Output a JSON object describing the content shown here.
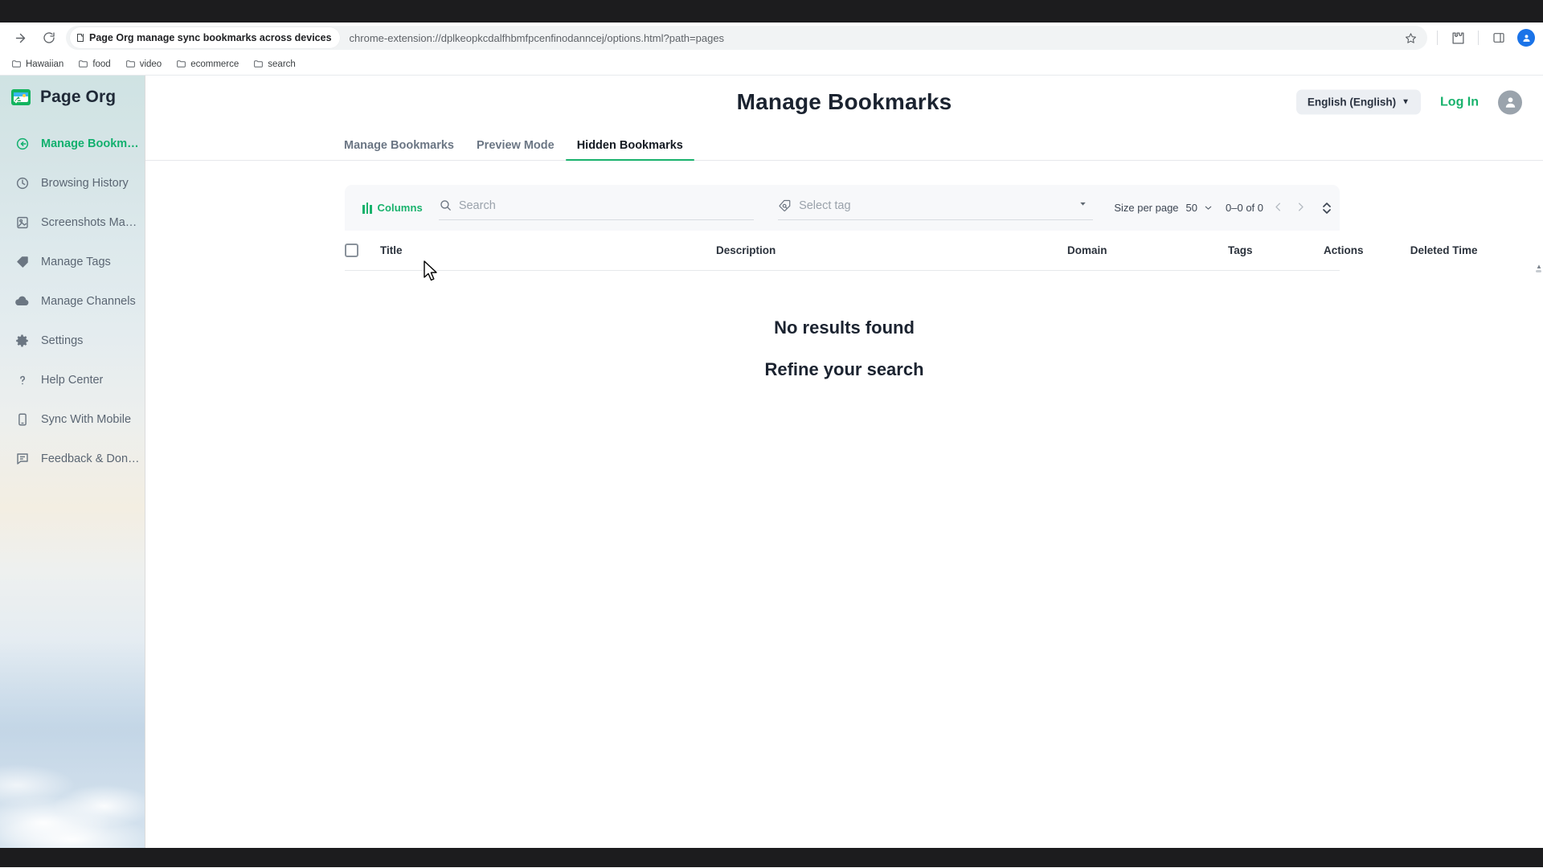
{
  "browser": {
    "forward_icon": "forward-arrow-icon",
    "reload_icon": "reload-icon",
    "omnibox_chip_label": "Page Org manage sync bookmarks across devices",
    "omnibox_chip_icon": "extension-puzzle-icon",
    "url": "chrome-extension://dplkeopkcdalfhbmfpcenfinodanncej/options.html?path=pages",
    "star_icon": "bookmark-star-icon",
    "extensions_icon": "extensions-puzzle-icon",
    "sidepanel_icon": "side-panel-icon",
    "profile_initial": "",
    "bookmarks": [
      {
        "label": "Hawaiian",
        "icon": "folder-icon"
      },
      {
        "label": "food",
        "icon": "folder-icon"
      },
      {
        "label": "video",
        "icon": "folder-icon"
      },
      {
        "label": "ecommerce",
        "icon": "folder-icon"
      },
      {
        "label": "search",
        "icon": "folder-icon"
      }
    ]
  },
  "sidebar": {
    "brand": "Page Org",
    "brand_icon": "page-org-logo-icon",
    "items": [
      {
        "label": "Manage Bookmarks",
        "icon": "bookmark-arrow-icon",
        "active": true
      },
      {
        "label": "Browsing History",
        "icon": "history-clock-icon",
        "active": false
      },
      {
        "label": "Screenshots Manage...",
        "icon": "screenshot-icon",
        "active": false
      },
      {
        "label": "Manage Tags",
        "icon": "tag-icon",
        "active": false
      },
      {
        "label": "Manage Channels",
        "icon": "cloud-icon",
        "active": false
      },
      {
        "label": "Settings",
        "icon": "gear-icon",
        "active": false
      },
      {
        "label": "Help Center",
        "icon": "question-mark-icon",
        "active": false
      },
      {
        "label": "Sync With Mobile",
        "icon": "mobile-sync-icon",
        "active": false
      },
      {
        "label": "Feedback & Donate",
        "icon": "feedback-icon",
        "active": false
      }
    ]
  },
  "header": {
    "title": "Manage Bookmarks",
    "language_label": "English (English)",
    "language_caret": "▼",
    "login_label": "Log In",
    "avatar_icon": "user-avatar-icon"
  },
  "tabs": [
    {
      "label": "Manage Bookmarks",
      "active": false
    },
    {
      "label": "Preview Mode",
      "active": false
    },
    {
      "label": "Hidden Bookmarks",
      "active": true
    }
  ],
  "toolbar": {
    "columns_label": "Columns",
    "columns_icon": "columns-bars-icon",
    "search_icon": "search-icon",
    "search_placeholder": "Search",
    "search_value": "",
    "tag_icon": "tag-search-icon",
    "tag_placeholder": "Select tag",
    "tag_value": "",
    "tag_caret_icon": "chevron-down-icon",
    "size_per_page_label": "Size per page",
    "size_per_page_value": "50",
    "size_caret_icon": "chevron-down-icon",
    "range_label": "0–0 of 0",
    "prev_icon": "chevron-left-icon",
    "next_icon": "chevron-right-icon",
    "sort_icon": "sort-updown-icon"
  },
  "table": {
    "select_all_checkbox": "select-all-checkbox",
    "columns": [
      "Title",
      "Description",
      "Domain",
      "Tags",
      "Actions",
      "Deleted Time"
    ]
  },
  "empty_state": {
    "line1": "No results found",
    "line2": "Refine your search"
  },
  "colors": {
    "accent_green": "#18b26c",
    "title_dark": "#1b2330",
    "muted": "#6b7684",
    "toolbar_bg": "#f7f8fa"
  }
}
